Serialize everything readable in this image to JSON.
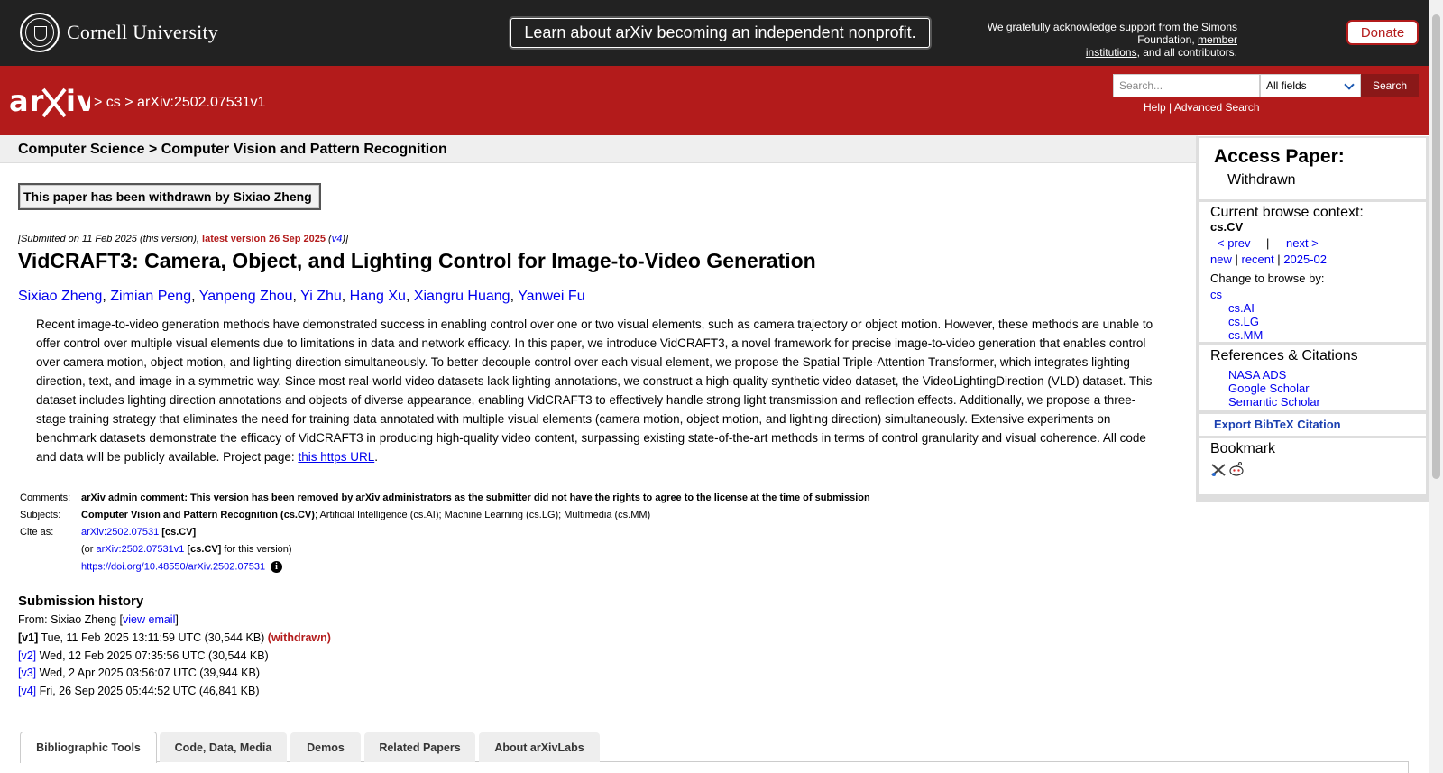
{
  "cornell": {
    "name": "Cornell University",
    "nonprofit_banner": "Learn about arXiv becoming an independent nonprofit.",
    "support_prefix": "We gratefully acknowledge support from the Simons Foundation, ",
    "support_link1": "member",
    "support_link2": "institutions",
    "support_suffix": ", and all contributors.",
    "donate_label": "Donate"
  },
  "header": {
    "logo_text": "arXiv",
    "breadcrumb": {
      "sep1": ">",
      "cs": "cs",
      "sep2": ">",
      "id": "arXiv:2502.07531v1"
    },
    "search_placeholder": "Search...",
    "field_selected": "All fields",
    "search_button": "Search",
    "help_link": "Help",
    "pipe": "|",
    "advanced_link": "Advanced Search"
  },
  "subheader": {
    "text": "Computer Science > Computer Vision and Pattern Recognition"
  },
  "paper": {
    "withdrawn_notice": "This paper has been withdrawn by Sixiao Zheng",
    "dateline_prefix": "[Submitted on 11 Feb 2025 (this version), ",
    "dateline_latest": "latest version 26 Sep 2025",
    "dateline_open": " (",
    "dateline_v4": "v4",
    "dateline_close": ")]",
    "title": "VidCRAFT3: Camera, Object, and Lighting Control for Image-to-Video Generation",
    "authors": [
      "Sixiao Zheng",
      "Zimian Peng",
      "Yanpeng Zhou",
      "Yi Zhu",
      "Hang Xu",
      "Xiangru Huang",
      "Yanwei Fu"
    ],
    "abstract": "Recent image-to-video generation methods have demonstrated success in enabling control over one or two visual elements, such as camera trajectory or object motion. However, these methods are unable to offer control over multiple visual elements due to limitations in data and network efficacy. In this paper, we introduce VidCRAFT3, a novel framework for precise image-to-video generation that enables control over camera motion, object motion, and lighting direction simultaneously. To better decouple control over each visual element, we propose the Spatial Triple-Attention Transformer, which integrates lighting direction, text, and image in a symmetric way. Since most real-world video datasets lack lighting annotations, we construct a high-quality synthetic video dataset, the VideoLightingDirection (VLD) dataset. This dataset includes lighting direction annotations and objects of diverse appearance, enabling VidCRAFT3 to effectively handle strong light transmission and reflection effects. Additionally, we propose a three-stage training strategy that eliminates the need for training data annotated with multiple visual elements (camera motion, object motion, and lighting direction) simultaneously. Extensive experiments on benchmark datasets demonstrate the efficacy of VidCRAFT3 in producing high-quality video content, surpassing existing state-of-the-art methods in terms of control granularity and visual coherence. All code and data will be publicly available. Project page: ",
    "abstract_link": "this https URL",
    "abstract_end": "."
  },
  "meta": {
    "comments_label": "Comments:",
    "comments": "arXiv admin comment: This version has been removed by arXiv administrators as the submitter did not have the rights to agree to the license at the time of submission",
    "subjects_label": "Subjects:",
    "subjects_primary": "Computer Vision and Pattern Recognition (cs.CV)",
    "subjects_rest": "; Artificial Intelligence (cs.AI); Machine Learning (cs.LG); Multimedia (cs.MM)",
    "cite_label": "Cite as:",
    "cite_id": "arXiv:2502.07531",
    "cite_cat": "[cs.CV]",
    "cite_or": "(or ",
    "cite_version_id": "arXiv:2502.07531v1",
    "cite_version_cat": "[cs.CV]",
    "cite_version_suffix": " for this version)",
    "doi": "https://doi.org/10.48550/arXiv.2502.07531",
    "info_glyph": "i"
  },
  "history": {
    "title": "Submission history",
    "from_prefix": "From: Sixiao Zheng [",
    "from_link": "view email",
    "from_suffix": "]",
    "versions": [
      {
        "label": "[v1]",
        "text": " Tue, 11 Feb 2025 13:11:59 UTC (30,544 KB) ",
        "flag": "(withdrawn)"
      },
      {
        "label": "[v2]",
        "text": " Wed, 12 Feb 2025 07:35:56 UTC (30,544 KB)"
      },
      {
        "label": "[v3]",
        "text": " Wed, 2 Apr 2025 03:56:07 UTC (39,944 KB)"
      },
      {
        "label": "[v4]",
        "text": " Fri, 26 Sep 2025 05:44:52 UTC (46,841 KB)"
      }
    ]
  },
  "tabs": [
    "Bibliographic Tools",
    "Code, Data, Media",
    "Demos",
    "Related Papers",
    "About arXivLabs"
  ],
  "sidebar": {
    "access_title": "Access Paper:",
    "access_status": "Withdrawn",
    "context_title": "Current browse context:",
    "context_value": "cs.CV",
    "prev": "< prev",
    "pipe": "|",
    "next": "next >",
    "new": "new",
    "recent": "recent",
    "month": "2025-02",
    "change_title": "Change to browse by:",
    "browse_cs": "cs",
    "browse_sub": [
      "cs.AI",
      "cs.LG",
      "cs.MM"
    ],
    "refs_title": "References & Citations",
    "refs": [
      "NASA ADS",
      "Google Scholar",
      "Semantic Scholar"
    ],
    "export": "Export BibTeX Citation",
    "bookmark_title": "Bookmark"
  },
  "colors": {
    "arxiv_red": "#b31b1b",
    "cornell_dark": "#222222",
    "link_blue": "#0000ee"
  }
}
